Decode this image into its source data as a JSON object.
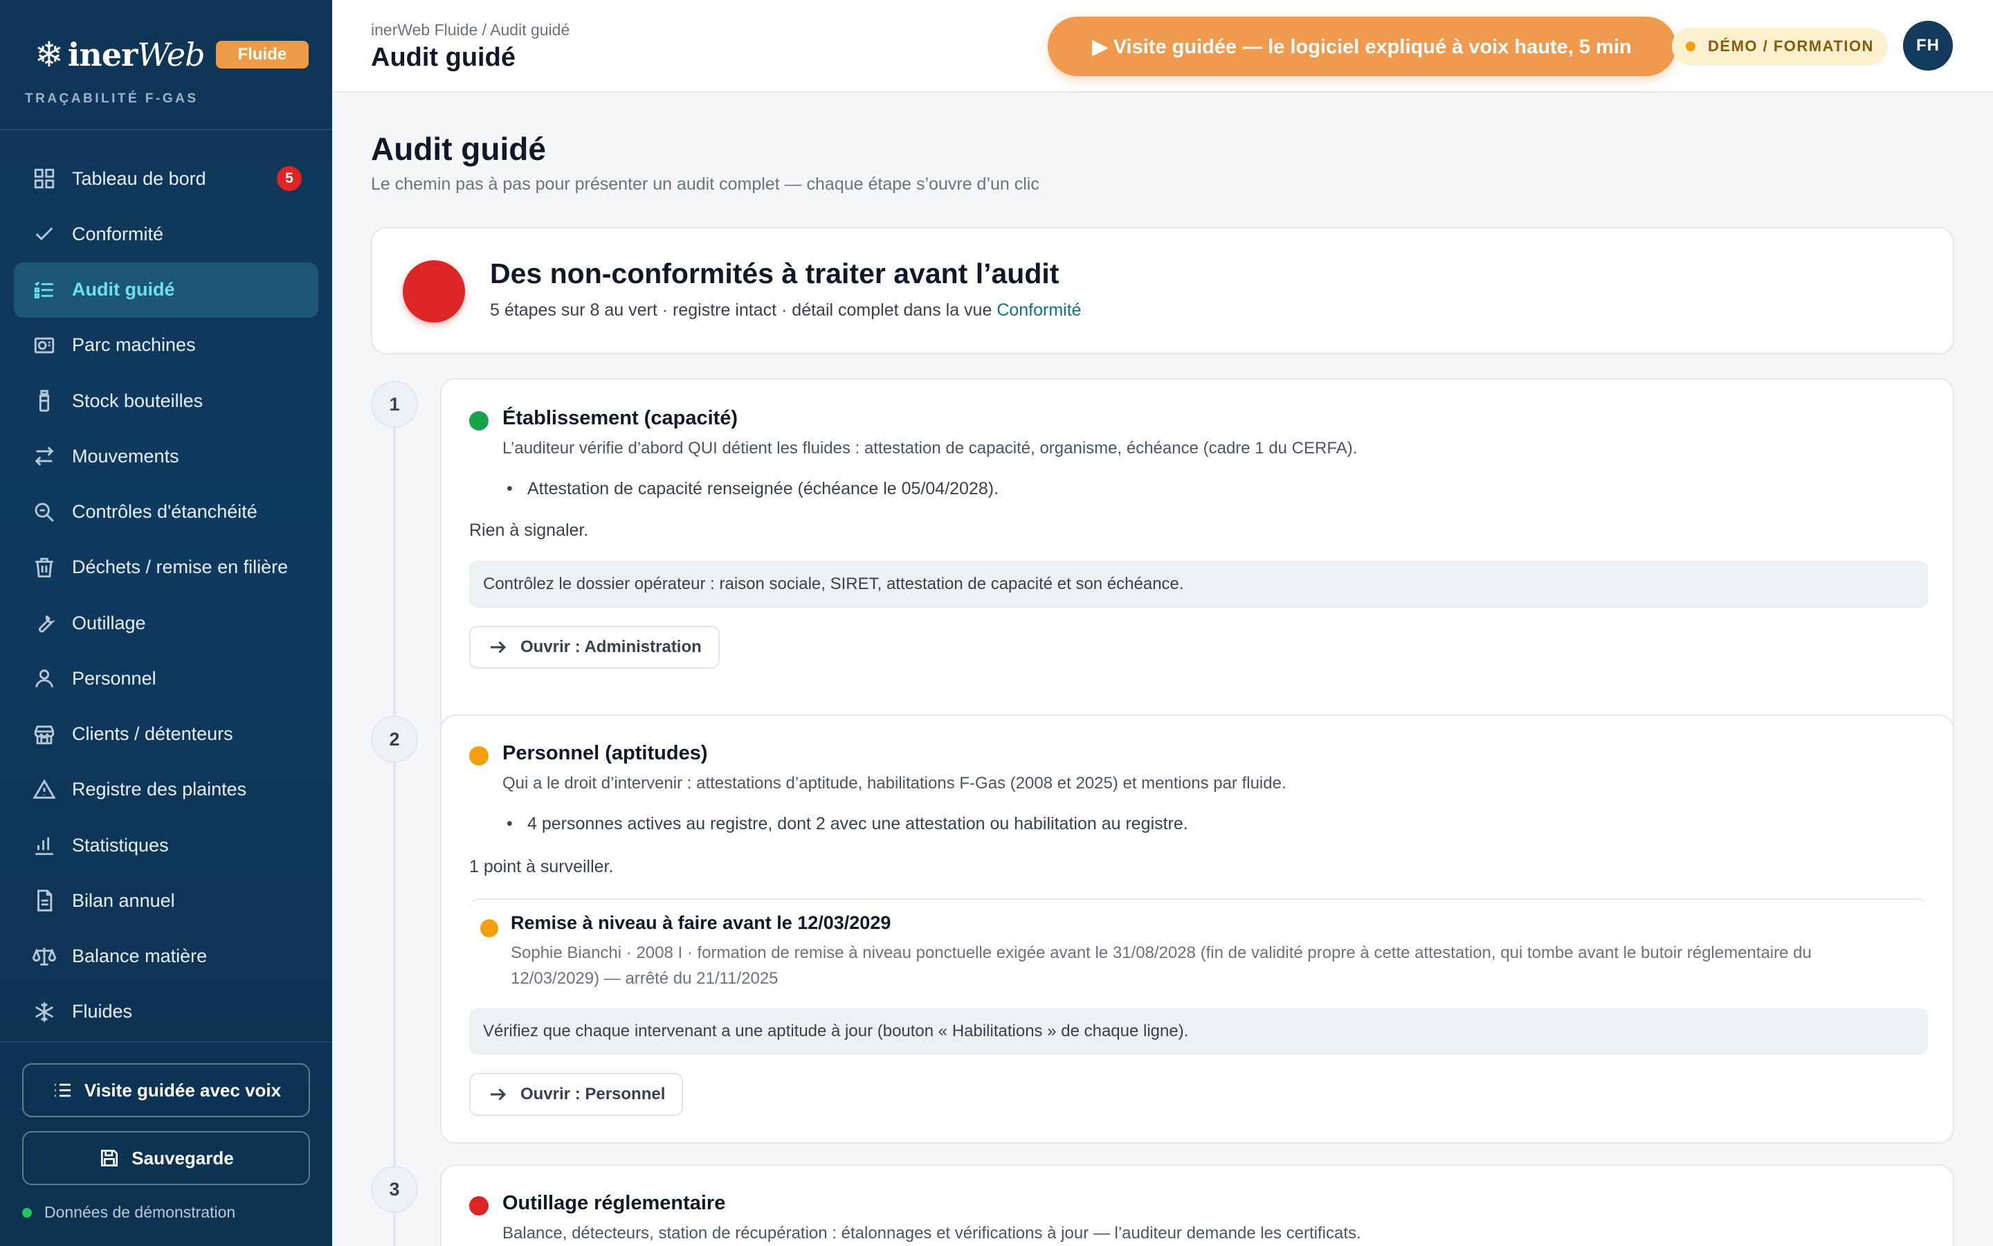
{
  "brand": {
    "name_prefix": "iner",
    "name_suffix": "Web",
    "pill": "Fluide",
    "tagline": "TRAÇABILITÉ F-GAS"
  },
  "sidebar": {
    "items": [
      {
        "label": "Tableau de bord",
        "icon": "grid-icon",
        "badge": "5"
      },
      {
        "label": "Conformité",
        "icon": "check-icon"
      },
      {
        "label": "Audit guidé",
        "icon": "checklist-icon",
        "active": true
      },
      {
        "label": "Parc machines",
        "icon": "machine-icon"
      },
      {
        "label": "Stock bouteilles",
        "icon": "bottle-icon"
      },
      {
        "label": "Mouvements",
        "icon": "transfer-icon"
      },
      {
        "label": "Contrôles d'étanchéité",
        "icon": "search-icon"
      },
      {
        "label": "Déchets / remise en filière",
        "icon": "trash-icon"
      },
      {
        "label": "Outillage",
        "icon": "wrench-icon"
      },
      {
        "label": "Personnel",
        "icon": "user-icon"
      },
      {
        "label": "Clients / détenteurs",
        "icon": "store-icon"
      },
      {
        "label": "Registre des plaintes",
        "icon": "warning-icon"
      },
      {
        "label": "Statistiques",
        "icon": "bar-chart-icon"
      },
      {
        "label": "Bilan annuel",
        "icon": "document-icon"
      },
      {
        "label": "Balance matière",
        "icon": "scale-icon"
      },
      {
        "label": "Fluides",
        "icon": "snowflake-icon"
      }
    ],
    "tour_button": "Visite guidée avec voix",
    "save_button": "Sauvegarde",
    "demo_data": "Données de démonstration"
  },
  "topbar": {
    "breadcrumb": "inerWeb Fluide / Audit guidé",
    "title": "Audit guidé",
    "tour_button": "▶ Visite guidée — le logiciel expliqué à voix haute, 5 min",
    "demo_badge": "DÉMO / FORMATION",
    "avatar": "FH"
  },
  "page": {
    "title": "Audit guidé",
    "subtitle": "Le chemin pas à pas pour présenter un audit complet — chaque étape s’ouvre d’un clic"
  },
  "summary": {
    "title": "Des non-conformités à traiter avant l’audit",
    "text": "5 étapes sur 8 au vert · registre intact · détail complet dans la vue ",
    "link": "Conformité",
    "status_color": "#dc2626"
  },
  "steps": [
    {
      "number": "1",
      "status_color": "#16a34a",
      "title": "Établissement (capacité)",
      "description": "L’auditeur vérifie d’abord QUI détient les fluides : attestation de capacité, organisme, échéance (cadre 1 du CERFA).",
      "bullet": "Attestation de capacité renseignée (échéance le 05/04/2028).",
      "verdict": "Rien à signaler.",
      "hint": "Contrôlez le dossier opérateur : raison sociale, SIRET, attestation de capacité et son échéance.",
      "open_label": "Ouvrir : Administration"
    },
    {
      "number": "2",
      "status_color": "#f59e0b",
      "title": "Personnel (aptitudes)",
      "description": "Qui a le droit d’intervenir : attestations d’aptitude, habilitations F-Gas (2008 et 2025) et mentions par fluide.",
      "bullet": "4 personnes actives au registre, dont 2 avec une attestation ou habilitation au registre.",
      "verdict": "1 point à surveiller.",
      "issue": {
        "title": "Remise à niveau à faire avant le 12/03/2029",
        "description": "Sophie Bianchi · 2008 I · formation de remise à niveau ponctuelle exigée avant le 31/08/2028 (fin de validité propre à cette attestation, qui tombe avant le butoir réglementaire du 12/03/2029) — arrêté du 21/11/2025"
      },
      "hint": "Vérifiez que chaque intervenant a une aptitude à jour (bouton « Habilitations » de chaque ligne).",
      "open_label": "Ouvrir : Personnel"
    },
    {
      "number": "3",
      "status_color": "#dc2626",
      "title": "Outillage réglementaire",
      "description": "Balance, détecteurs, station de récupération : étalonnages et vérifications à jour — l’auditeur demande les certificats."
    }
  ]
}
